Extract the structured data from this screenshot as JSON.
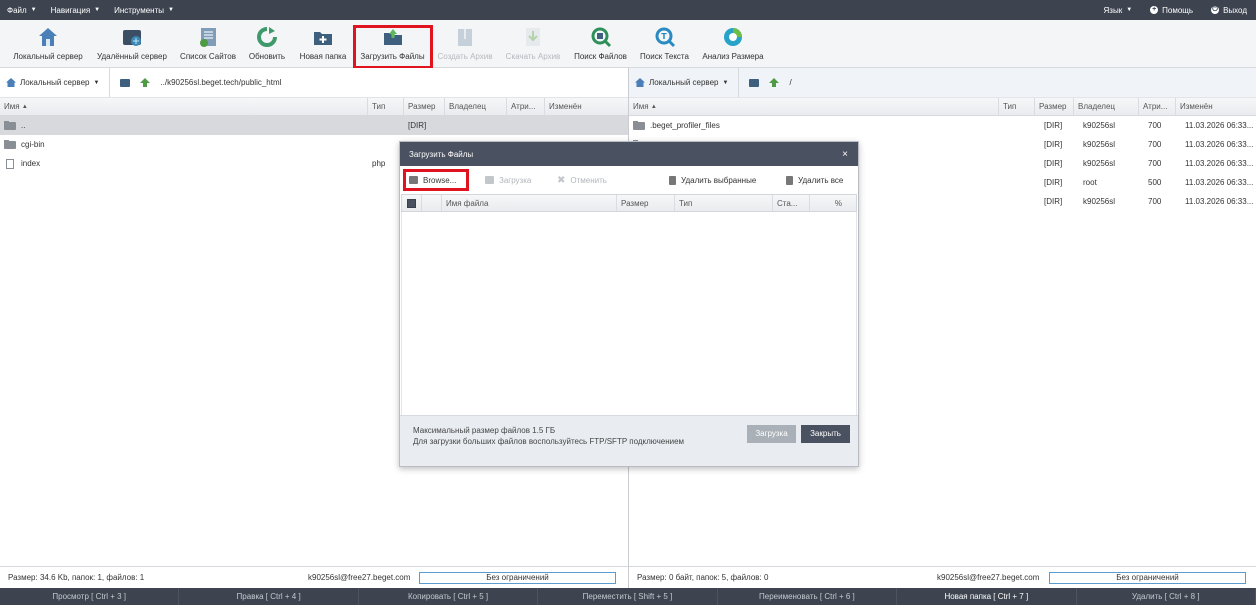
{
  "menu": {
    "left": [
      {
        "label": "Файл"
      },
      {
        "label": "Навигация"
      },
      {
        "label": "Инструменты"
      }
    ],
    "right": {
      "language": "Язык",
      "help": "Помощь",
      "logout": "Выход"
    }
  },
  "toolbar": {
    "buttons": [
      {
        "label": "Локальный сервер",
        "icon": "home-icon",
        "color": "#4a7fb8"
      },
      {
        "label": "Удалённый сервер",
        "icon": "remote-server-icon",
        "color": "#3b88b5"
      },
      {
        "label": "Список Сайтов",
        "icon": "sites-list-icon",
        "color": "#6a8fb0"
      },
      {
        "label": "Обновить",
        "icon": "refresh-icon",
        "color": "#3f9a6b"
      },
      {
        "label": "Новая папка",
        "icon": "new-folder-icon",
        "color": "#3e5f7e"
      },
      {
        "label": "Загрузить Файлы",
        "icon": "upload-files-icon",
        "color": "#3e5f7e"
      },
      {
        "label": "Создать Архив",
        "icon": "create-archive-icon",
        "color": "#8fa4b8"
      },
      {
        "label": "Скачать Архив",
        "icon": "download-archive-icon",
        "color": "#a8c68f"
      },
      {
        "label": "Поиск Файлов",
        "icon": "search-files-icon",
        "color": "#2f8f5a"
      },
      {
        "label": "Поиск Текста",
        "icon": "search-text-icon",
        "color": "#2a8ac2"
      },
      {
        "label": "Анализ Размера",
        "icon": "size-analysis-icon",
        "color": "#27a3c9"
      }
    ]
  },
  "left_panel": {
    "server": "Локальный сервер",
    "path": "../k90256sl.beget.tech/public_html",
    "columns": [
      "Имя",
      "Тип",
      "Размер",
      "Владелец",
      "Атри...",
      "Изменён"
    ],
    "rows": [
      {
        "name": "..",
        "type": "",
        "size": "[DIR]",
        "kind": "folder"
      },
      {
        "name": "cgi-bin",
        "type": "",
        "size": "",
        "kind": "folder"
      },
      {
        "name": "index",
        "type": "php",
        "size": "",
        "kind": "file"
      }
    ],
    "status": "Размер: 34.6 Kb, папок: 1, файлов: 1",
    "user": "k90256sl@free27.beget.com",
    "limit": "Без ограничений"
  },
  "right_panel": {
    "server": "Локальный сервер",
    "path": "/",
    "columns": [
      "Имя",
      "Тип",
      "Размер",
      "Владелец",
      "Атри...",
      "Изменён"
    ],
    "rows": [
      {
        "name": ".beget_profiler_files",
        "type": "",
        "size": "[DIR]",
        "owner": "k90256sl",
        "attr": "700",
        "modified": "11.03.2026 06:33..."
      },
      {
        "name": "",
        "type": "",
        "size": "[DIR]",
        "owner": "k90256sl",
        "attr": "700",
        "modified": "11.03.2026 06:33..."
      },
      {
        "name": "",
        "type": "",
        "size": "[DIR]",
        "owner": "k90256sl",
        "attr": "700",
        "modified": "11.03.2026 06:33..."
      },
      {
        "name": "",
        "type": "",
        "size": "[DIR]",
        "owner": "root",
        "attr": "500",
        "modified": "11.03.2026 06:33..."
      },
      {
        "name": "",
        "type": "",
        "size": "[DIR]",
        "owner": "k90256sl",
        "attr": "700",
        "modified": "11.03.2026 06:33..."
      }
    ],
    "status": "Размер: 0 байт, папок: 5, файлов: 0",
    "user": "k90256sl@free27.beget.com",
    "limit": "Без ограничений"
  },
  "dialog": {
    "title": "Загрузить Файлы",
    "close": "×",
    "tools": {
      "browse": "Browse...",
      "upload": "Загрузка",
      "cancel": "Отменить",
      "delete_selected": "Удалить выбранные",
      "delete_all": "Удалить все"
    },
    "columns": [
      "Имя файла",
      "Размер",
      "Тип",
      "Ста...",
      "%"
    ],
    "info_line1": "Максимальный размер файлов 1.5 ГБ",
    "info_line2": "Для загрузки больших файлов воспользуйтесь FTP/SFTP подключением",
    "upload_button": "Загрузка",
    "close_button": "Закрыть"
  },
  "hotkeys": [
    {
      "label": "Просмотр [ Ctrl + 3 ]",
      "active": false
    },
    {
      "label": "Правка [ Ctrl + 4 ]",
      "active": false
    },
    {
      "label": "Копировать [ Ctrl + 5 ]",
      "active": false
    },
    {
      "label": "Переместить [ Shift + 5 ]",
      "active": false
    },
    {
      "label": "Переименовать [ Ctrl + 6 ]",
      "active": false
    },
    {
      "label": "Новая папка [ Ctrl + 7 ]",
      "active": true
    },
    {
      "label": "Удалить [ Ctrl + 8 ]",
      "active": false
    }
  ],
  "colors": {
    "header": "#3d4450",
    "dialog_header": "#4a5160",
    "highlight": "#e0141e",
    "selection": "#d7d9dc"
  }
}
